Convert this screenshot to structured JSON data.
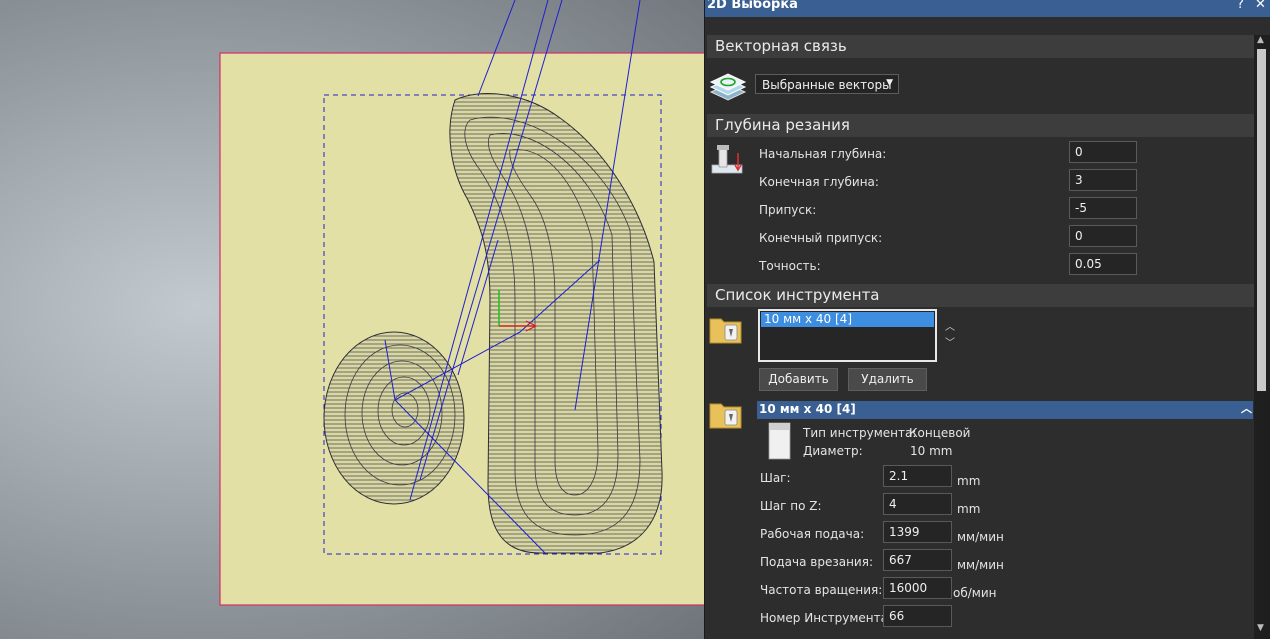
{
  "window": {
    "title": "2D Выборка",
    "help": "?",
    "close": "✕"
  },
  "sections": {
    "vector_link": "Векторная связь",
    "cut_depth": "Глубина резания",
    "tool_list": "Список инструмента"
  },
  "vector_link": {
    "selected": "Выбранные векторы"
  },
  "depth": {
    "start_label": "Начальная глубина:",
    "start_value": "0",
    "end_label": "Конечная глубина:",
    "end_value": "3",
    "allowance_label": "Припуск:",
    "allowance_value": "-5",
    "final_allowance_label": "Конечный припуск:",
    "final_allowance_value": "0",
    "accuracy_label": "Точность:",
    "accuracy_value": "0.05"
  },
  "tools": {
    "items": [
      "10 мм x 40 [4]"
    ],
    "add_label": "Добавить",
    "remove_label": "Удалить"
  },
  "tool_detail": {
    "header": "10 мм x 40 [4]",
    "type_label": "Тип инструмента:",
    "type_value": "Концевой",
    "diameter_label": "Диаметр:",
    "diameter_value": "10 mm",
    "step_label": "Шаг:",
    "step_value": "2.1",
    "step_unit": "mm",
    "zstep_label": "Шаг по Z:",
    "zstep_value": "4",
    "zstep_unit": "mm",
    "feed_label": "Рабочая подача:",
    "feed_value": "1399",
    "feed_unit": "мм/мин",
    "plunge_label": "Подача врезания:",
    "plunge_value": "667",
    "plunge_unit": "мм/мин",
    "speed_label": "Частота вращения:",
    "speed_value": "16000",
    "speed_unit": "об/мин",
    "number_label": "Номер Инструмента:",
    "number_value": "66"
  },
  "colors": {
    "panel_bg": "#2d2d2d",
    "title_bar": "#3a5f93",
    "selection": "#3d8ee0",
    "material": "#e2e0a4",
    "toolpath": "#1f1fd0",
    "stock_border": "#d0306a"
  }
}
